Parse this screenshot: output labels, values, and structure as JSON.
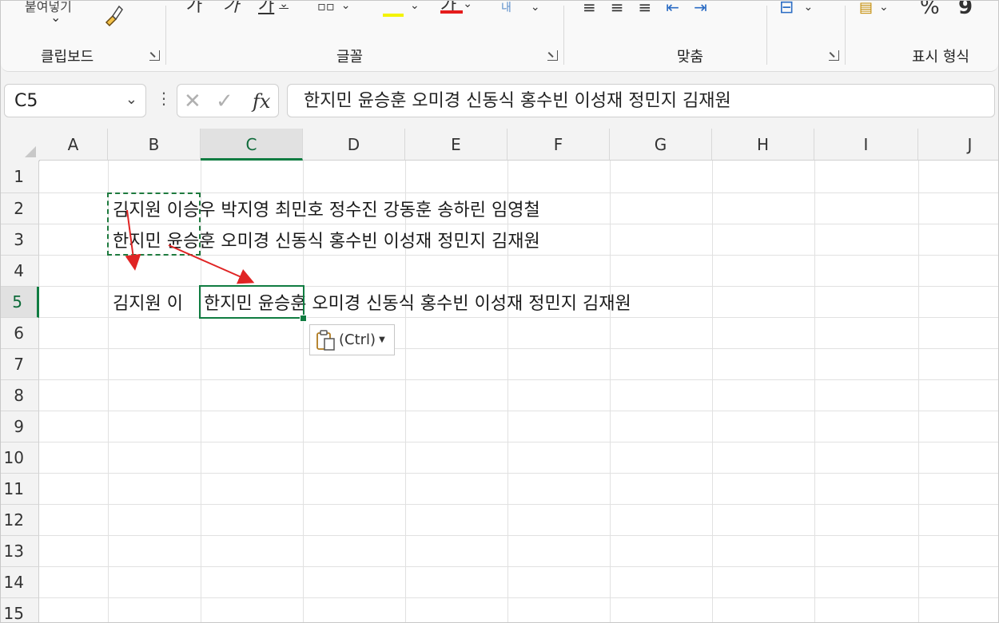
{
  "ribbon": {
    "groups": [
      {
        "label": "클립보드"
      },
      {
        "label": "글꼴"
      },
      {
        "label": "맞춤"
      },
      {
        "label": "표시 형식"
      }
    ],
    "top_partial_texts": [
      "붙여넣기",
      "가",
      "가",
      "가",
      "가",
      "가",
      "%",
      "9"
    ]
  },
  "formula_bar": {
    "name_box": "C5",
    "fx_label": "fx",
    "formula": "한지민 윤승훈 오미경 신동식 홍수빈 이성재 정민지 김재원"
  },
  "columns": [
    "A",
    "B",
    "C",
    "D",
    "E",
    "F",
    "G",
    "H",
    "I",
    "J"
  ],
  "rows": [
    "1",
    "2",
    "3",
    "4",
    "5",
    "6",
    "7",
    "8",
    "9",
    "10",
    "11",
    "12",
    "13",
    "14",
    "15"
  ],
  "selected_column": "C",
  "selected_row": "5",
  "cells": {
    "b2": "김지원 이승우 박지영 최민호 정수진 강동훈 송하린 임영철",
    "b3": "한지민 윤승훈 오미경 신동식 홍수빈 이성재 정민지 김재원",
    "b5": "김지원 이",
    "c5": "한지민 윤승훈 오미경 신동식 홍수빈 이성재 정민지 김재원"
  },
  "paste_options": {
    "label": "(Ctrl)"
  },
  "colors": {
    "accent": "#107c41",
    "arrow": "#e02424"
  }
}
